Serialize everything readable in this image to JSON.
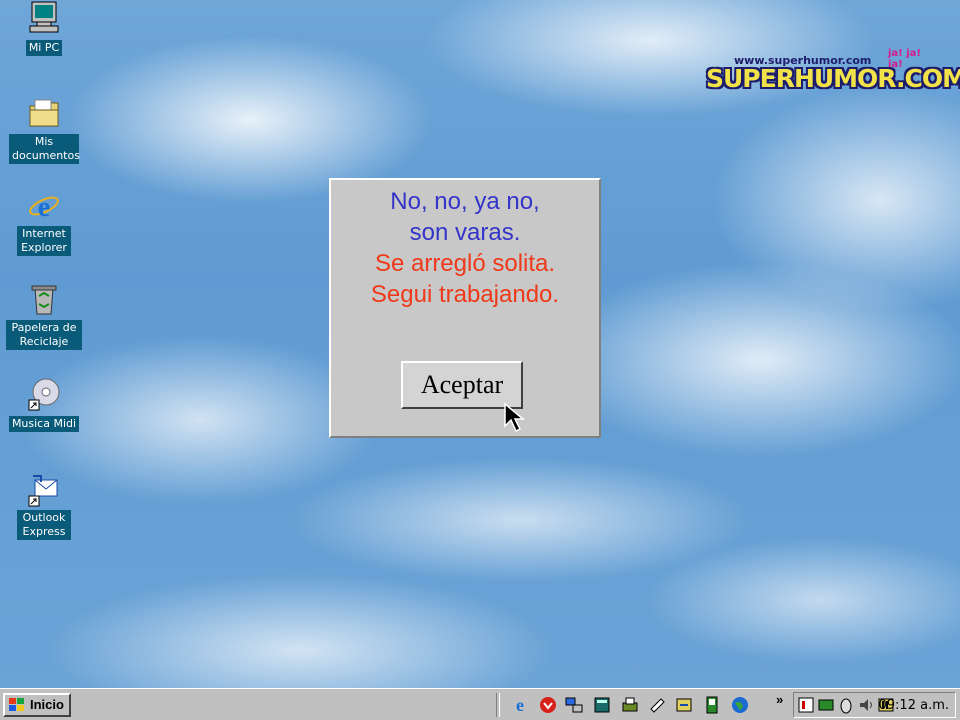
{
  "desktop": {
    "icons": [
      {
        "label": "Mi PC",
        "icon": "computer-icon"
      },
      {
        "label": "Mis documentos",
        "icon": "folder-icon"
      },
      {
        "label": "Internet Explorer",
        "icon": "internet-explorer-icon"
      },
      {
        "label": "Papelera de Reciclaje",
        "icon": "recycle-bin-icon"
      },
      {
        "label": "Musica Midi",
        "icon": "cd-shortcut-icon"
      },
      {
        "label": "Outlook Express",
        "icon": "outlook-express-icon"
      }
    ]
  },
  "logo": {
    "url": "www.superhumor.com",
    "brand": "SUPERHUMOR.COM",
    "laughs": "ja! ja! ja!"
  },
  "dialog": {
    "line1": "No, no, ya no,",
    "line2": "son varas.",
    "line3": "Se arregló solita.",
    "line4": "Segui trabajando.",
    "button": "Aceptar",
    "colors": {
      "blue_text": "#3434c8",
      "red_text": "#ee3a1a"
    }
  },
  "taskbar": {
    "start_label": "Inicio",
    "quick_launch": [
      "internet-explorer-icon",
      "outlook-icon",
      "network-icon",
      "calculator-icon",
      "printer-icon",
      "paint-icon",
      "wizard-icon",
      "notepad-icon",
      "globe-icon"
    ],
    "chevron": "»",
    "tray_icons": [
      "mixer-icon",
      "network-tray-icon",
      "mouse-icon",
      "volume-icon",
      "media-icon"
    ],
    "clock": "09:12 a.m."
  }
}
